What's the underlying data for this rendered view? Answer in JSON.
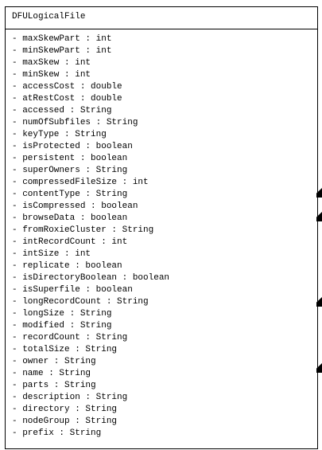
{
  "class_name": "DFULogicalFile",
  "attributes": [
    "- maxSkewPart : int",
    "- minSkewPart : int",
    "- maxSkew : int",
    "- minSkew : int",
    "- accessCost : double",
    "- atRestCost : double",
    "- accessed : String",
    "- numOfSubfiles : String",
    "- keyType : String",
    "- isProtected : boolean",
    "- persistent : boolean",
    "- superOwners : String",
    "- compressedFileSize : int",
    "- contentType : String",
    "- isCompressed : boolean",
    "- browseData : boolean",
    "- fromRoxieCluster : String",
    "- intRecordCount : int",
    "- intSize : int",
    "- replicate : boolean",
    "- isDirectoryBoolean : boolean",
    "- isSuperfile : boolean",
    "- longRecordCount : String",
    "- longSize : String",
    "- modified : String",
    "- recordCount : String",
    "- totalSize : String",
    "- owner : String",
    "- name : String",
    "- parts : String",
    "- description : String",
    "- directory : String",
    "- nodeGroup : String",
    "- prefix : String"
  ]
}
